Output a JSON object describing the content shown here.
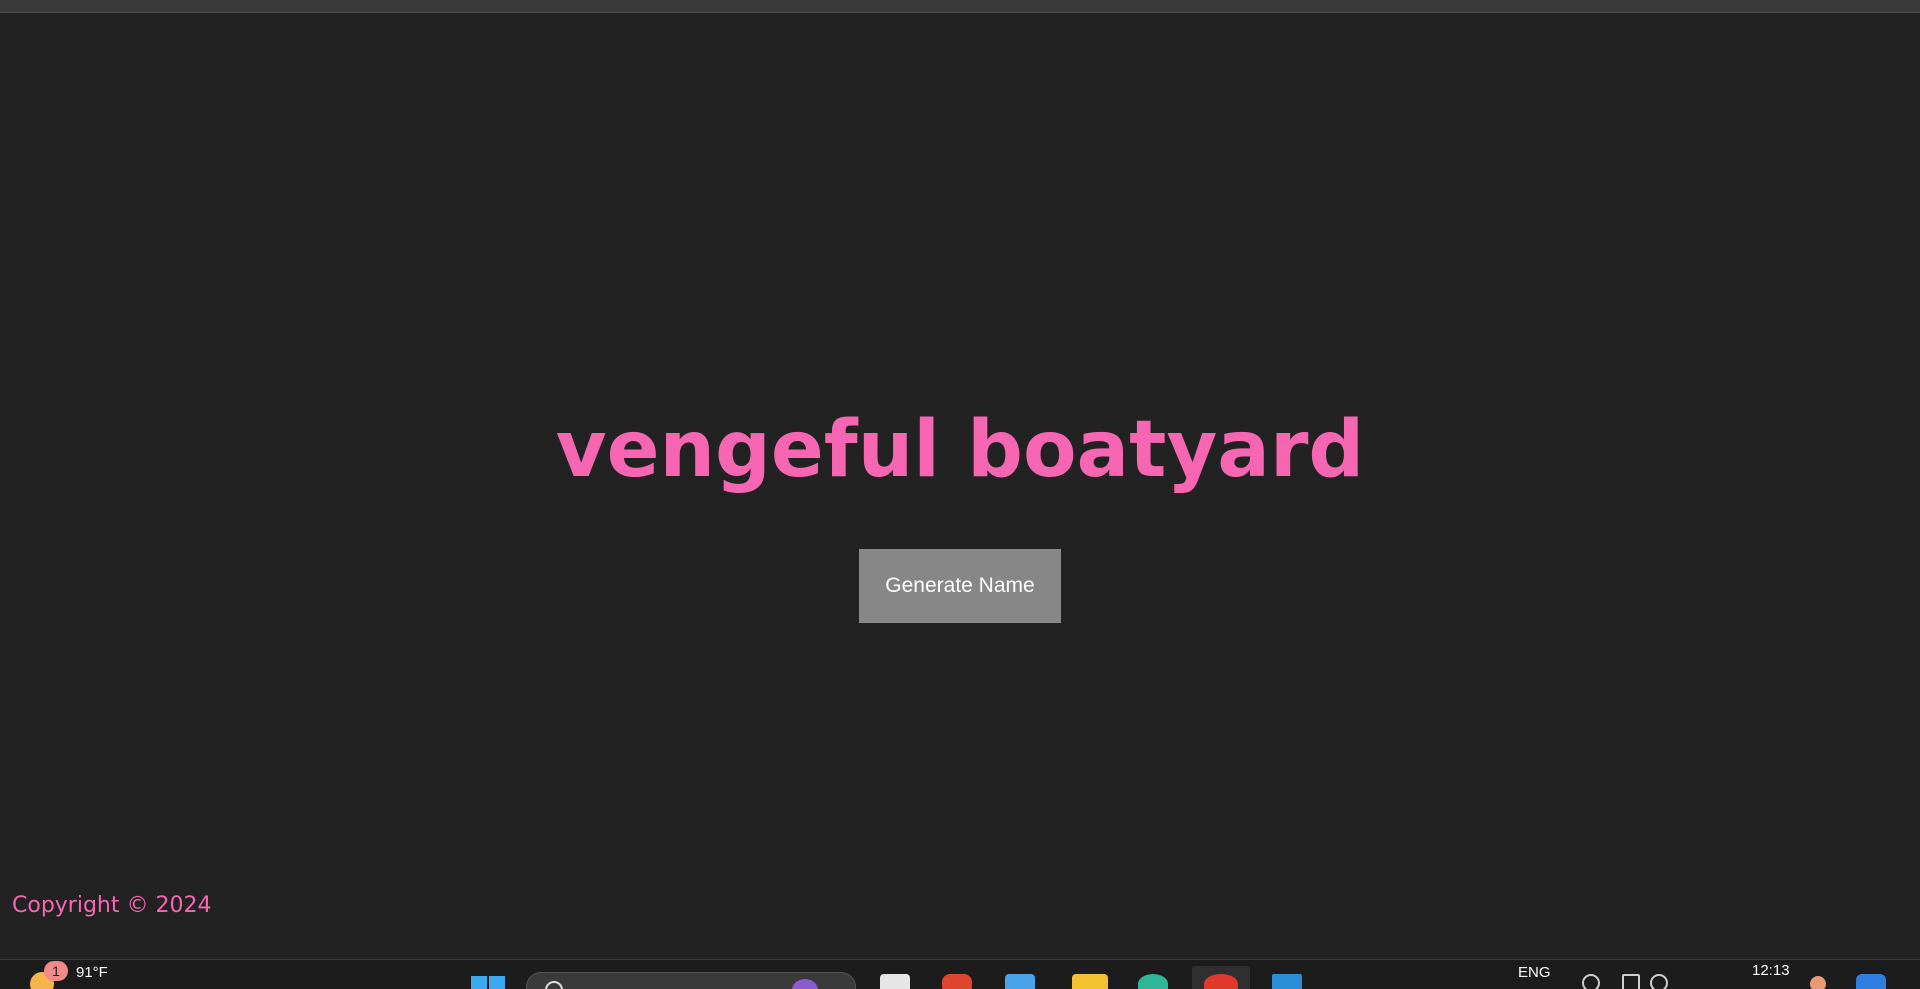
{
  "app": {
    "generated_name": "vengeful boatyard",
    "generate_button_label": "Generate Name",
    "copyright": "Copyright © 2024"
  },
  "taskbar": {
    "weather_badge": "1",
    "weather_temp": "91°F",
    "language": "ENG",
    "clock": "12:13",
    "apps": [
      "file-explorer-icon",
      "brave-icon",
      "store-icon",
      "folder-icon",
      "edge-icon",
      "chrome-icon",
      "vscode-icon"
    ]
  },
  "colors": {
    "background": "#222222",
    "accent_pink": "#f766b2",
    "button_gray": "#878787"
  }
}
